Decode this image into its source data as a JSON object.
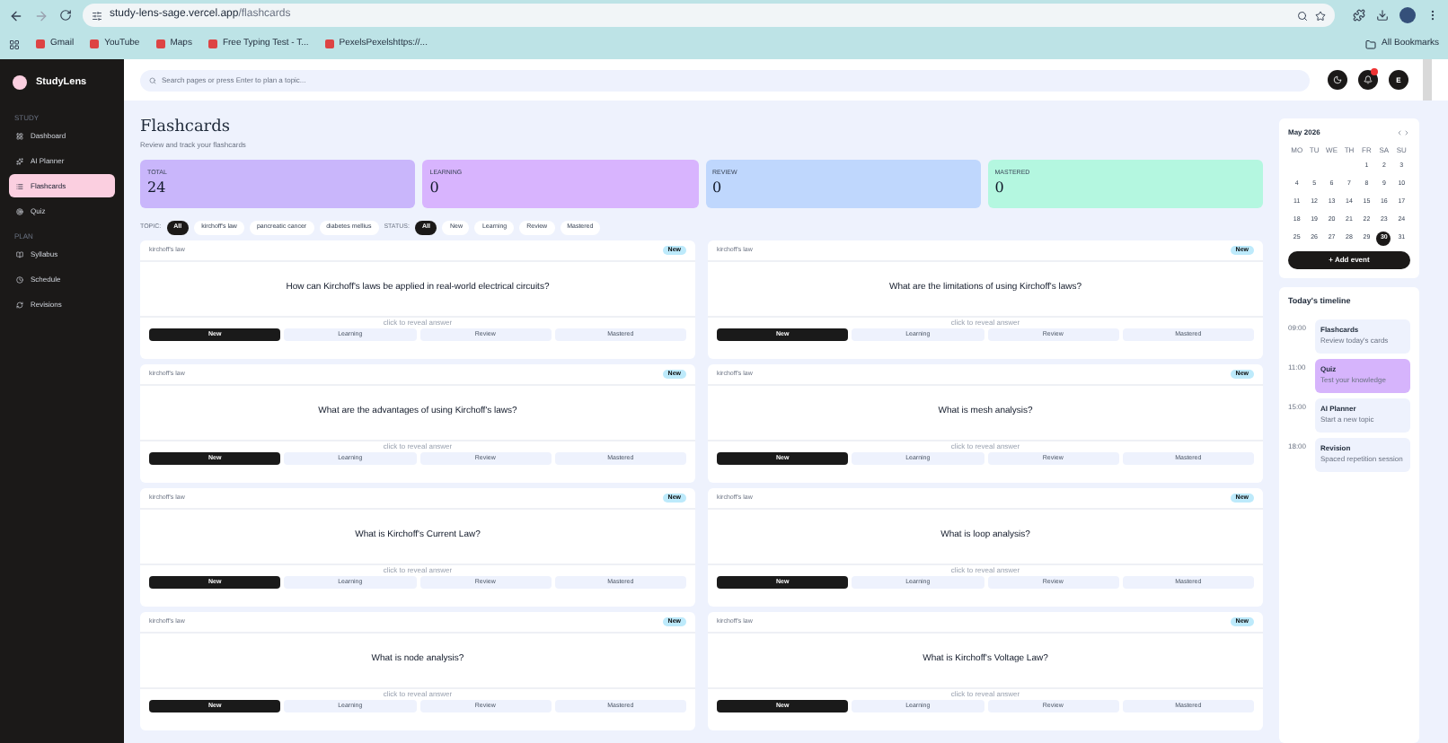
{
  "browser": {
    "url_host": "study-lens-sage.vercel.app",
    "url_path": "/flashcards",
    "bookmarks": [
      "Gmail",
      "YouTube",
      "Maps",
      "Free Typing Test - T...",
      "PexelsPexelshttps://..."
    ],
    "all_bookmarks": "All Bookmarks"
  },
  "sidebar": {
    "brand": "StudyLens",
    "sections": [
      {
        "title": "STUDY",
        "items": [
          {
            "label": "Dashboard",
            "selected": false
          },
          {
            "label": "AI Planner",
            "selected": false
          },
          {
            "label": "Flashcards",
            "selected": true
          },
          {
            "label": "Quiz",
            "selected": false
          }
        ]
      },
      {
        "title": "PLAN",
        "items": [
          {
            "label": "Syllabus",
            "selected": false
          },
          {
            "label": "Schedule",
            "selected": false
          },
          {
            "label": "Revisions",
            "selected": false
          }
        ]
      }
    ]
  },
  "search": {
    "placeholder": "Search pages or press Enter to plan a topic..."
  },
  "header": {
    "notifications": true,
    "avatar": "E"
  },
  "page": {
    "title": "Flashcards",
    "subtitle": "Review and track your flashcards"
  },
  "stats": [
    {
      "label": "TOTAL",
      "value": "24",
      "color": "#c9b6fb"
    },
    {
      "label": "LEARNING",
      "value": "0",
      "color": "#d8b4fe"
    },
    {
      "label": "REVIEW",
      "value": "0",
      "color": "#bfd7fd"
    },
    {
      "label": "MASTERED",
      "value": "0",
      "color": "#b4f7e0"
    }
  ],
  "filters": [
    {
      "label": "TOPIC:",
      "options": [
        {
          "label": "All",
          "selected": true
        },
        {
          "label": "kirchoff's law",
          "selected": false
        },
        {
          "label": "pancreatic cancer",
          "selected": false
        },
        {
          "label": "diabetes mellius",
          "selected": false
        }
      ]
    },
    {
      "label": "STATUS:",
      "options": [
        {
          "label": "All",
          "selected": true
        },
        {
          "label": "New",
          "selected": false
        },
        {
          "label": "Learning",
          "selected": false
        },
        {
          "label": "Review",
          "selected": false
        },
        {
          "label": "Mastered",
          "selected": false
        }
      ]
    }
  ],
  "cards": [
    {
      "topic": "kirchoff's law",
      "badge": "New",
      "question": "How can Kirchoff's laws be applied in real-world electrical circuits?",
      "hint": "click to reveal answer",
      "statuses": [
        {
          "label": "New",
          "selected": true
        },
        {
          "label": "Learning",
          "selected": false
        },
        {
          "label": "Review",
          "selected": false
        },
        {
          "label": "Mastered",
          "selected": false
        }
      ]
    },
    {
      "topic": "kirchoff's law",
      "badge": "New",
      "question": "What are the limitations of using Kirchoff's laws?",
      "hint": "click to reveal answer",
      "statuses": [
        {
          "label": "New",
          "selected": true
        },
        {
          "label": "Learning",
          "selected": false
        },
        {
          "label": "Review",
          "selected": false
        },
        {
          "label": "Mastered",
          "selected": false
        }
      ]
    },
    {
      "topic": "kirchoff's law",
      "badge": "New",
      "question": "What are the advantages of using Kirchoff's laws?",
      "hint": "click to reveal answer",
      "statuses": [
        {
          "label": "New",
          "selected": true
        },
        {
          "label": "Learning",
          "selected": false
        },
        {
          "label": "Review",
          "selected": false
        },
        {
          "label": "Mastered",
          "selected": false
        }
      ]
    },
    {
      "topic": "kirchoff's law",
      "badge": "New",
      "question": "What is mesh analysis?",
      "hint": "click to reveal answer",
      "statuses": [
        {
          "label": "New",
          "selected": true
        },
        {
          "label": "Learning",
          "selected": false
        },
        {
          "label": "Review",
          "selected": false
        },
        {
          "label": "Mastered",
          "selected": false
        }
      ]
    },
    {
      "topic": "kirchoff's law",
      "badge": "New",
      "question": "What is Kirchoff's Current Law?",
      "hint": "click to reveal answer",
      "statuses": [
        {
          "label": "New",
          "selected": true
        },
        {
          "label": "Learning",
          "selected": false
        },
        {
          "label": "Review",
          "selected": false
        },
        {
          "label": "Mastered",
          "selected": false
        }
      ]
    },
    {
      "topic": "kirchoff's law",
      "badge": "New",
      "question": "What is loop analysis?",
      "hint": "click to reveal answer",
      "statuses": [
        {
          "label": "New",
          "selected": true
        },
        {
          "label": "Learning",
          "selected": false
        },
        {
          "label": "Review",
          "selected": false
        },
        {
          "label": "Mastered",
          "selected": false
        }
      ]
    },
    {
      "topic": "kirchoff's law",
      "badge": "New",
      "question": "What is node analysis?",
      "hint": "click to reveal answer",
      "statuses": [
        {
          "label": "New",
          "selected": true
        },
        {
          "label": "Learning",
          "selected": false
        },
        {
          "label": "Review",
          "selected": false
        },
        {
          "label": "Mastered",
          "selected": false
        }
      ]
    },
    {
      "topic": "kirchoff's law",
      "badge": "New",
      "question": "What is Kirchoff's Voltage Law?",
      "hint": "click to reveal answer",
      "statuses": [
        {
          "label": "New",
          "selected": true
        },
        {
          "label": "Learning",
          "selected": false
        },
        {
          "label": "Review",
          "selected": false
        },
        {
          "label": "Mastered",
          "selected": false
        }
      ]
    }
  ],
  "calendar": {
    "month": "May 2026",
    "weekdays": [
      "MO",
      "TU",
      "WE",
      "TH",
      "FR",
      "SA",
      "SU"
    ],
    "weeks": [
      {
        "days": [
          {
            "day": "1",
            "selected": false
          },
          {
            "day": "2",
            "selected": false
          },
          {
            "day": "3",
            "selected": false
          }
        ]
      },
      {
        "days": [
          {
            "day": "4",
            "selected": false
          },
          {
            "day": "5",
            "selected": false
          },
          {
            "day": "6",
            "selected": false
          },
          {
            "day": "7",
            "selected": false
          },
          {
            "day": "8",
            "selected": false
          },
          {
            "day": "9",
            "selected": false
          },
          {
            "day": "10",
            "selected": false
          }
        ]
      },
      {
        "days": [
          {
            "day": "11",
            "selected": false
          },
          {
            "day": "12",
            "selected": false
          },
          {
            "day": "13",
            "selected": false
          },
          {
            "day": "14",
            "selected": false
          },
          {
            "day": "15",
            "selected": false
          },
          {
            "day": "16",
            "selected": false
          },
          {
            "day": "17",
            "selected": false
          }
        ]
      },
      {
        "days": [
          {
            "day": "18",
            "selected": false
          },
          {
            "day": "19",
            "selected": false
          },
          {
            "day": "20",
            "selected": false
          },
          {
            "day": "21",
            "selected": false
          },
          {
            "day": "22",
            "selected": false
          },
          {
            "day": "23",
            "selected": false
          },
          {
            "day": "24",
            "selected": false
          }
        ]
      },
      {
        "days": [
          {
            "day": "25",
            "selected": false
          },
          {
            "day": "26",
            "selected": false
          },
          {
            "day": "27",
            "selected": false
          },
          {
            "day": "28",
            "selected": false
          },
          {
            "day": "29",
            "selected": false
          },
          {
            "day": "30",
            "selected": true
          },
          {
            "day": "31",
            "selected": false
          }
        ]
      }
    ],
    "add_button": "+ Add event"
  },
  "timeline": {
    "title": "Today's timeline",
    "events": [
      {
        "time": "09:00",
        "title": "Flashcards",
        "subtitle": "Review today's cards",
        "selected": false
      },
      {
        "time": "11:00",
        "title": "Quiz",
        "subtitle": "Test your knowledge",
        "selected": true
      },
      {
        "time": "15:00",
        "title": "AI Planner",
        "subtitle": "Start a new topic",
        "selected": false
      },
      {
        "time": "18:00",
        "title": "Revision",
        "subtitle": "Spaced repetition session",
        "selected": false
      }
    ]
  }
}
